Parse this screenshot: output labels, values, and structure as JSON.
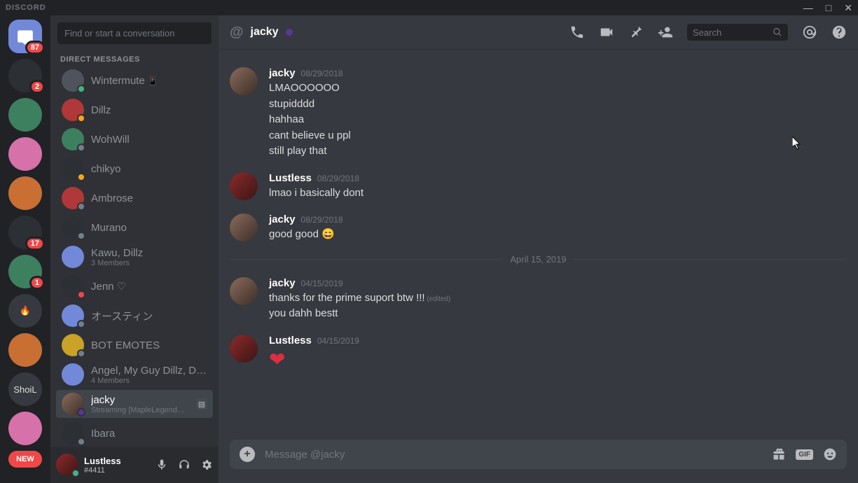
{
  "titlebar": {
    "logo": "DISCORD"
  },
  "servers": [
    {
      "name": "home",
      "badge": "87",
      "active": true,
      "avatar_class": "av-blue"
    },
    {
      "name": "server-1",
      "badge": "2",
      "avatar_class": "av-dark"
    },
    {
      "name": "server-2",
      "avatar_class": "av-green"
    },
    {
      "name": "server-3",
      "avatar_class": "av-pink"
    },
    {
      "name": "server-4",
      "avatar_class": "av-orange"
    },
    {
      "name": "server-5",
      "badge": "17",
      "avatar_class": "av-dark"
    },
    {
      "name": "server-6",
      "badge": "1",
      "avatar_class": "av-green"
    },
    {
      "name": "server-7",
      "label": "🔥"
    },
    {
      "name": "server-8",
      "avatar_class": "av-orange"
    },
    {
      "name": "server-shoil",
      "label": "ShoiL"
    },
    {
      "name": "server-9",
      "avatar_class": "av-pink"
    },
    {
      "name": "new",
      "label": "NEW",
      "is_new": true
    }
  ],
  "sidebar": {
    "search_placeholder": "Find or start a conversation",
    "section_label": "DIRECT MESSAGES",
    "items": [
      {
        "name": "Wintermute",
        "status": "online",
        "extra_icon": "phone-icon"
      },
      {
        "name": "Dillz",
        "status": "idle",
        "avatar_class": "av-red"
      },
      {
        "name": "WohWill",
        "status": "offline",
        "avatar_class": "av-green"
      },
      {
        "name": "chikyo",
        "status": "idle",
        "avatar_class": "av-dark"
      },
      {
        "name": "Ambrose",
        "status": "offline",
        "avatar_class": "av-red"
      },
      {
        "name": "Murano",
        "status": "offline",
        "avatar_class": "av-dark"
      },
      {
        "name": "Kawu, Dillz",
        "sub": "3 Members",
        "avatar_class": "av-blue"
      },
      {
        "name": "Jenn ♡",
        "status": "dnd",
        "avatar_class": "av-dark"
      },
      {
        "name": "オースティン",
        "status": "offline",
        "avatar_class": "av-blue"
      },
      {
        "name": "BOT EMOTES",
        "status": "offline",
        "avatar_class": "av-yellow"
      },
      {
        "name": "Angel, My Guy Dillz, Dillz",
        "sub": "4 Members",
        "avatar_class": "av-blue"
      },
      {
        "name": "jacky",
        "sub": "Streaming [MapleLegends] - N...",
        "status": "streaming",
        "selected": true,
        "rich_presence": true,
        "avatar_class": "av-j"
      },
      {
        "name": "Ibara",
        "status": "offline",
        "avatar_class": "av-dark"
      }
    ]
  },
  "user_panel": {
    "name": "Lustless",
    "tag": "#4411",
    "status": "online",
    "avatar_class": "av-l"
  },
  "header": {
    "at": "@",
    "title": "jacky",
    "status": "streaming",
    "search_placeholder": "Search"
  },
  "messages": [
    {
      "author": "jacky",
      "time": "08/29/2018",
      "avatar_class": "av-j",
      "lines": [
        "LMAOOOOOO",
        "stupidddd",
        "hahhaa",
        "cant believe u ppl",
        "still play that"
      ]
    },
    {
      "author": "Lustless",
      "time": "08/29/2018",
      "avatar_class": "av-l",
      "lines": [
        "lmao i basically dont"
      ]
    },
    {
      "author": "jacky",
      "time": "08/29/2018",
      "avatar_class": "av-j",
      "lines": [
        "good good 😄"
      ]
    },
    {
      "divider": "April 15, 2019"
    },
    {
      "author": "jacky",
      "time": "04/15/2019",
      "avatar_class": "av-j",
      "lines": [
        "thanks for the prime suport btw !!!",
        "you dahh bestt"
      ],
      "edited_on_line": 0,
      "edited_label": "(edited)"
    },
    {
      "author": "Lustless",
      "time": "04/15/2019",
      "avatar_class": "av-l",
      "heart": true
    }
  ],
  "composer": {
    "placeholder": "Message @jacky",
    "gif_label": "GIF"
  }
}
